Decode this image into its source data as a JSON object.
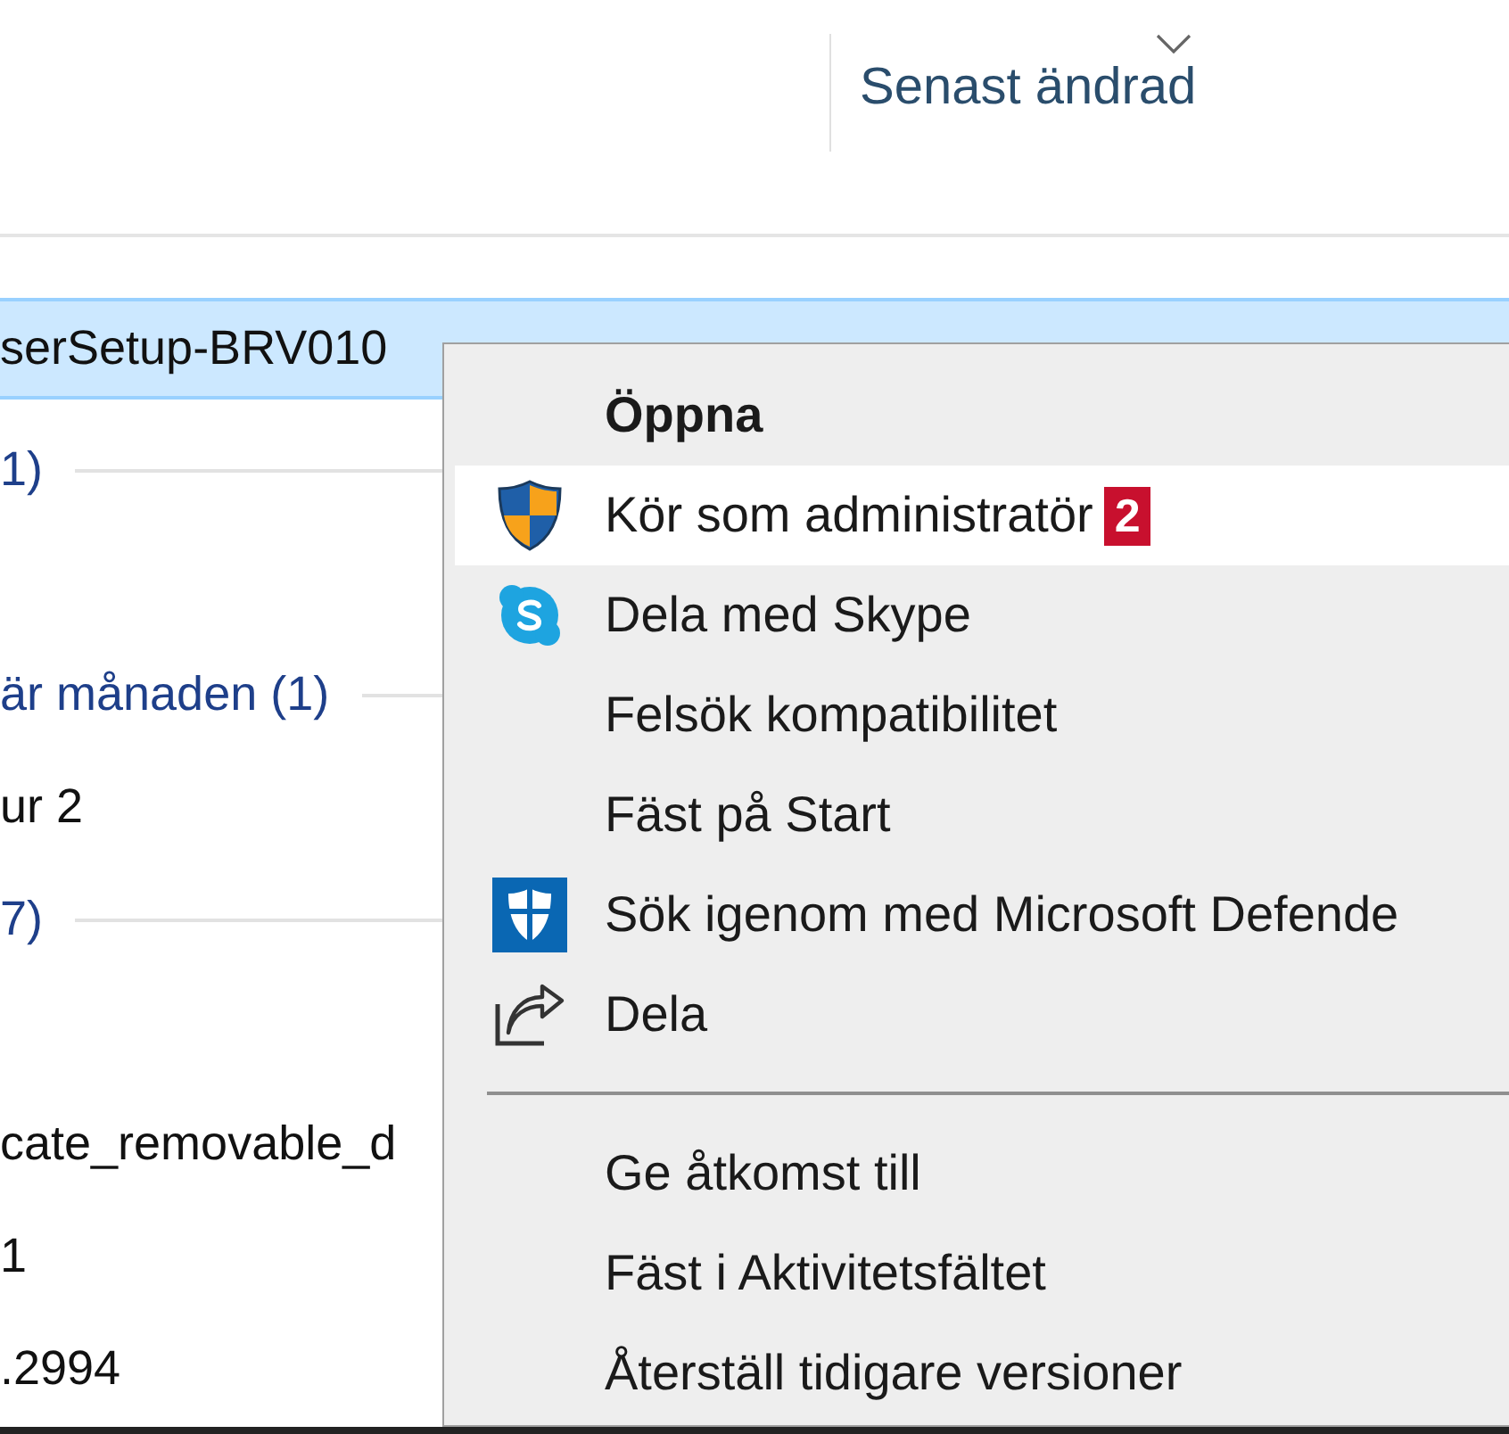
{
  "column_header": {
    "label": "Senast ändrad"
  },
  "file_list": [
    {
      "kind": "file",
      "name": "serSetup-BRV010",
      "selected": true
    },
    {
      "kind": "group",
      "label": "1)"
    },
    {
      "kind": "spacer"
    },
    {
      "kind": "group",
      "label": "är månaden (1)"
    },
    {
      "kind": "file",
      "name": "ur 2",
      "selected": false
    },
    {
      "kind": "group",
      "label": "7)"
    },
    {
      "kind": "spacer"
    },
    {
      "kind": "file",
      "name": "cate_removable_d",
      "selected": false
    },
    {
      "kind": "file",
      "name": "1",
      "selected": false
    },
    {
      "kind": "file",
      "name": ".2994",
      "selected": false
    }
  ],
  "context_menu": [
    {
      "kind": "item",
      "label": "Öppna",
      "bold": true,
      "selected": false
    },
    {
      "kind": "item",
      "label": "Kör som administratör",
      "bold": false,
      "selected": true,
      "badge": "2"
    },
    {
      "kind": "item",
      "label": "Dela med Skype",
      "bold": false,
      "selected": false
    },
    {
      "kind": "item",
      "label": "Felsök kompatibilitet",
      "bold": false,
      "selected": false
    },
    {
      "kind": "item",
      "label": "Fäst på Start",
      "bold": false,
      "selected": false
    },
    {
      "kind": "item",
      "label": "Sök igenom med Microsoft Defende",
      "bold": false,
      "selected": false
    },
    {
      "kind": "item",
      "label": "Dela",
      "bold": false,
      "selected": false
    },
    {
      "kind": "separator"
    },
    {
      "kind": "item",
      "label": "Ge åtkomst till",
      "bold": false,
      "selected": false
    },
    {
      "kind": "item",
      "label": "Fäst i Aktivitetsfältet",
      "bold": false,
      "selected": false
    },
    {
      "kind": "item",
      "label": "Återställ tidigare versioner",
      "bold": false,
      "selected": false
    }
  ]
}
